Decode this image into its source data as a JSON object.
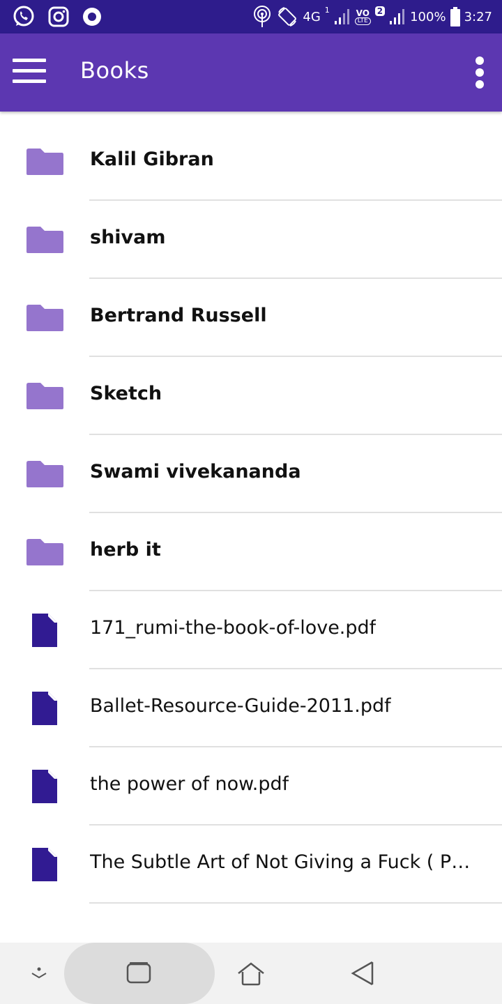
{
  "status_bar": {
    "network": "4G",
    "sim1": "1",
    "sim2": "2",
    "volte": "VO",
    "lte": "LTE",
    "battery": "100%",
    "time": "3:27"
  },
  "app_bar": {
    "title": "Books"
  },
  "items": [
    {
      "type": "folder",
      "name": "Kalil Gibran"
    },
    {
      "type": "folder",
      "name": "shivam"
    },
    {
      "type": "folder",
      "name": "Bertrand Russell"
    },
    {
      "type": "folder",
      "name": "Sketch"
    },
    {
      "type": "folder",
      "name": "Swami vivekananda"
    },
    {
      "type": "folder",
      "name": "herb it"
    },
    {
      "type": "file",
      "name": "171_rumi-the-book-of-love.pdf"
    },
    {
      "type": "file",
      "name": "Ballet-Resource-Guide-2011.pdf"
    },
    {
      "type": "file",
      "name": "the power of now.pdf"
    },
    {
      "type": "file",
      "name": "The Subtle Art of Not Giving a Fuck ( PDFDr..."
    }
  ],
  "icons": {
    "folder": "folder-icon",
    "file": "file-icon",
    "menu": "menu-icon",
    "more": "more-vert-icon"
  },
  "colors": {
    "status_bar": "#2e1c8c",
    "app_bar": "#5c37b1",
    "folder": "#9575cd",
    "file": "#311b92"
  }
}
